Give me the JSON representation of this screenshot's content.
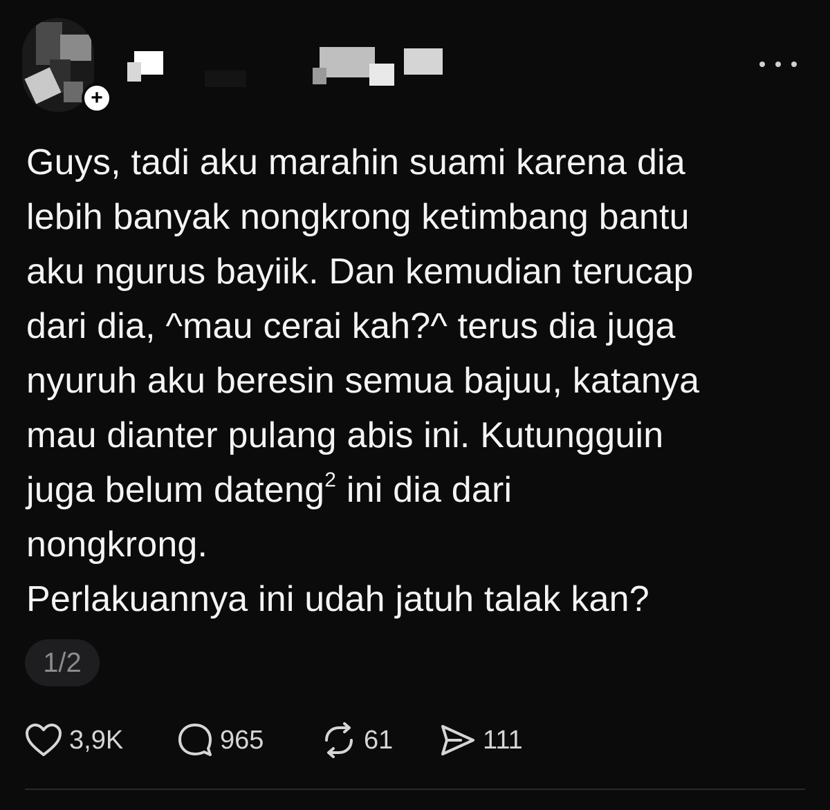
{
  "post": {
    "text_lines": [
      "Guys, tadi aku marahin suami karena dia",
      "lebih banyak nongkrong ketimbang bantu",
      "aku ngurus bayiik. Dan kemudian terucap",
      "dari dia, ^mau cerai kah?^ terus dia juga",
      "nyuruh aku beresin semua bajuu, katanya",
      "mau dianter pulang abis ini. Kutungguin",
      "juga belum dateng",
      "2",
      " ini dia dari",
      "nongkrong.",
      "Perlakuannya ini udah jatuh talak kan?"
    ],
    "page_indicator": "1/2"
  },
  "header": {
    "follow_badge": "+",
    "more_icon": "more-horizontal-icon"
  },
  "actions": {
    "like_count": "3,9K",
    "reply_count": "965",
    "repost_count": "61",
    "share_count": "111",
    "icons": [
      "heart-icon",
      "reply-bubble-icon",
      "repost-icon",
      "share-send-icon"
    ]
  },
  "colors": {
    "background": "#0b0b0c",
    "text": "#f4f4f4",
    "muted": "#8b8b8f",
    "pill": "#1e1e20"
  }
}
